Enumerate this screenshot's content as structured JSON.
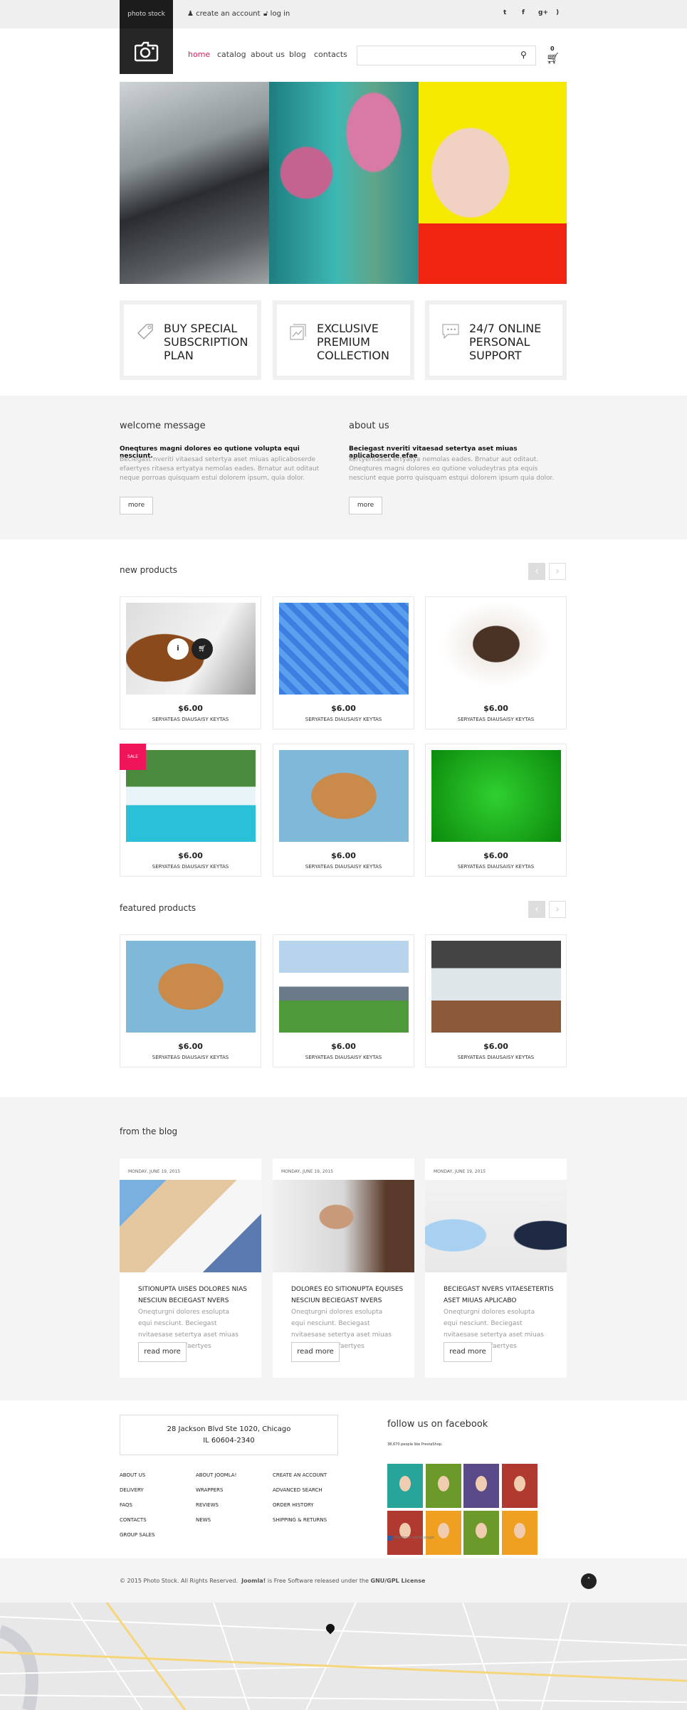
{
  "topbar": {
    "brand": "photo stock",
    "create_account": "create an account",
    "login": "log in",
    "social": [
      "twitter-icon",
      "facebook-icon",
      "google-plus-icon",
      "rss-icon"
    ]
  },
  "nav": {
    "items": [
      "home",
      "catalog",
      "about us",
      "blog",
      "contacts"
    ],
    "active": "home",
    "search_placeholder": "",
    "cart_count": "0"
  },
  "colors": {
    "accent": "#e5175e",
    "dark": "#1c1c1c",
    "section_gray": "#f4f4f4"
  },
  "features": [
    {
      "icon": "tag-icon",
      "title": "BUY SPECIAL SUBSCRIPTION PLAN"
    },
    {
      "icon": "gallery-icon",
      "title": "EXCLUSIVE PREMIUM COLLECTION"
    },
    {
      "icon": "chat-icon",
      "title": "24/7 ONLINE PERSONAL SUPPORT"
    }
  ],
  "welcome": {
    "title": "welcome message",
    "lead": "Oneqtures magni dolores eo qutione volupta equi nesciunt.",
    "body": "Beciegast nveriti vitaesad setertya aset miuas aplicaboserde efaertyes ritaesa ertyatya nemolas eades. Brnatur aut oditaut neque porroas quisquam estui dolorem ipsum, quia dolor.",
    "button": "more"
  },
  "about": {
    "title": "about us",
    "lead": "Beciegast nveriti vitaesad setertya aset miuas aplicaboserde efae",
    "body": "kertyeritaesa ertyatya nemolas eades. Brnatur aut oditaut. Oneqtures magni dolores eo qutione voludeytras pta equis nesciunt eque porro quisquam estqui dolorem ipsum quia dolor.",
    "button": "more"
  },
  "new_products": {
    "title": "new products",
    "items": [
      {
        "price": "$6.00",
        "name": "SERYATEAS DIAUSAISY KEYTAS",
        "image": "food"
      },
      {
        "price": "$6.00",
        "name": "SERYATEAS DIAUSAISY KEYTAS",
        "image": "letters"
      },
      {
        "price": "$6.00",
        "name": "SERYATEAS DIAUSAISY KEYTAS",
        "image": "puppy"
      },
      {
        "price": "$6.00",
        "name": "SERYATEAS DIAUSAISY KEYTAS",
        "image": "waterfall",
        "badge": "SALE"
      },
      {
        "price": "$6.00",
        "name": "SERYATEAS DIAUSAISY KEYTAS",
        "image": "kitten"
      },
      {
        "price": "$6.00",
        "name": "SERYATEAS DIAUSAISY KEYTAS",
        "image": "green"
      }
    ]
  },
  "featured_products": {
    "title": "featured products",
    "items": [
      {
        "price": "$6.00",
        "name": "SERYATEAS DIAUSAISY KEYTAS",
        "image": "kitten"
      },
      {
        "price": "$6.00",
        "name": "SERYATEAS DIAUSAISY KEYTAS",
        "image": "mountains"
      },
      {
        "price": "$6.00",
        "name": "SERYATEAS DIAUSAISY KEYTAS",
        "image": "interior"
      }
    ]
  },
  "blog": {
    "title": "from the blog",
    "posts": [
      {
        "date": "MONDAY, JUNE 19, 2015",
        "title": "SITIONUPTA UISES DOLORES NIAS NESCIUN BECIEGAST NVERS",
        "body": "Oneqturgni dolores esolupta equi nesciunt. Beciegast nvitaesase setertya aset miuas aplicabserde efaertyes ritaesatyatys.",
        "button": "read more"
      },
      {
        "date": "MONDAY, JUNE 19, 2015",
        "title": "DOLORES EO SITIONUPTA EQUISES NESCIUN BECIEGAST NVERS",
        "body": "Oneqturgni dolores esolupta equi nesciunt. Beciegast nvitaesase setertya aset miuas aplicabserde efaertyes ritaesatyatys.",
        "button": "read more"
      },
      {
        "date": "MONDAY, JUNE 19, 2015",
        "title": "BECIEGAST NVERS VITAESETERTIS ASET MIUAS APLICABO",
        "body": "Oneqturgni dolores esolupta equi nesciunt. Beciegast nvitaesase setertya aset miuas aplicabserde efaertyes ritaesatyatys.",
        "button": "read more"
      }
    ]
  },
  "footer": {
    "address_line1": "28 Jackson Blvd Ste 1020, Chicago",
    "address_line2": "IL 60604-2340",
    "links": [
      [
        "ABOUT US",
        "DELIVERY",
        "FAQS",
        "CONTACTS",
        "GROUP SALES"
      ],
      [
        "ABOUT JOOMLA!",
        "WRAPPERS",
        "REVIEWS",
        "NEWS"
      ],
      [
        "CREATE AN ACCOUNT",
        "ADVANCED SEARCH",
        "ORDER HISTORY",
        "SHIPPING & RETURNS"
      ]
    ],
    "facebook_title": "follow us on facebook",
    "facebook_likes": "38,670 people like PrestaShop.",
    "facebook_plugin": "Facebook social plugin",
    "copyright": "© 2015 Photo Stock. All Rights Reserved.",
    "joomla": "Joomla!",
    "free_sw": "is Free Software released under the",
    "license": "GNU/GPL License"
  }
}
